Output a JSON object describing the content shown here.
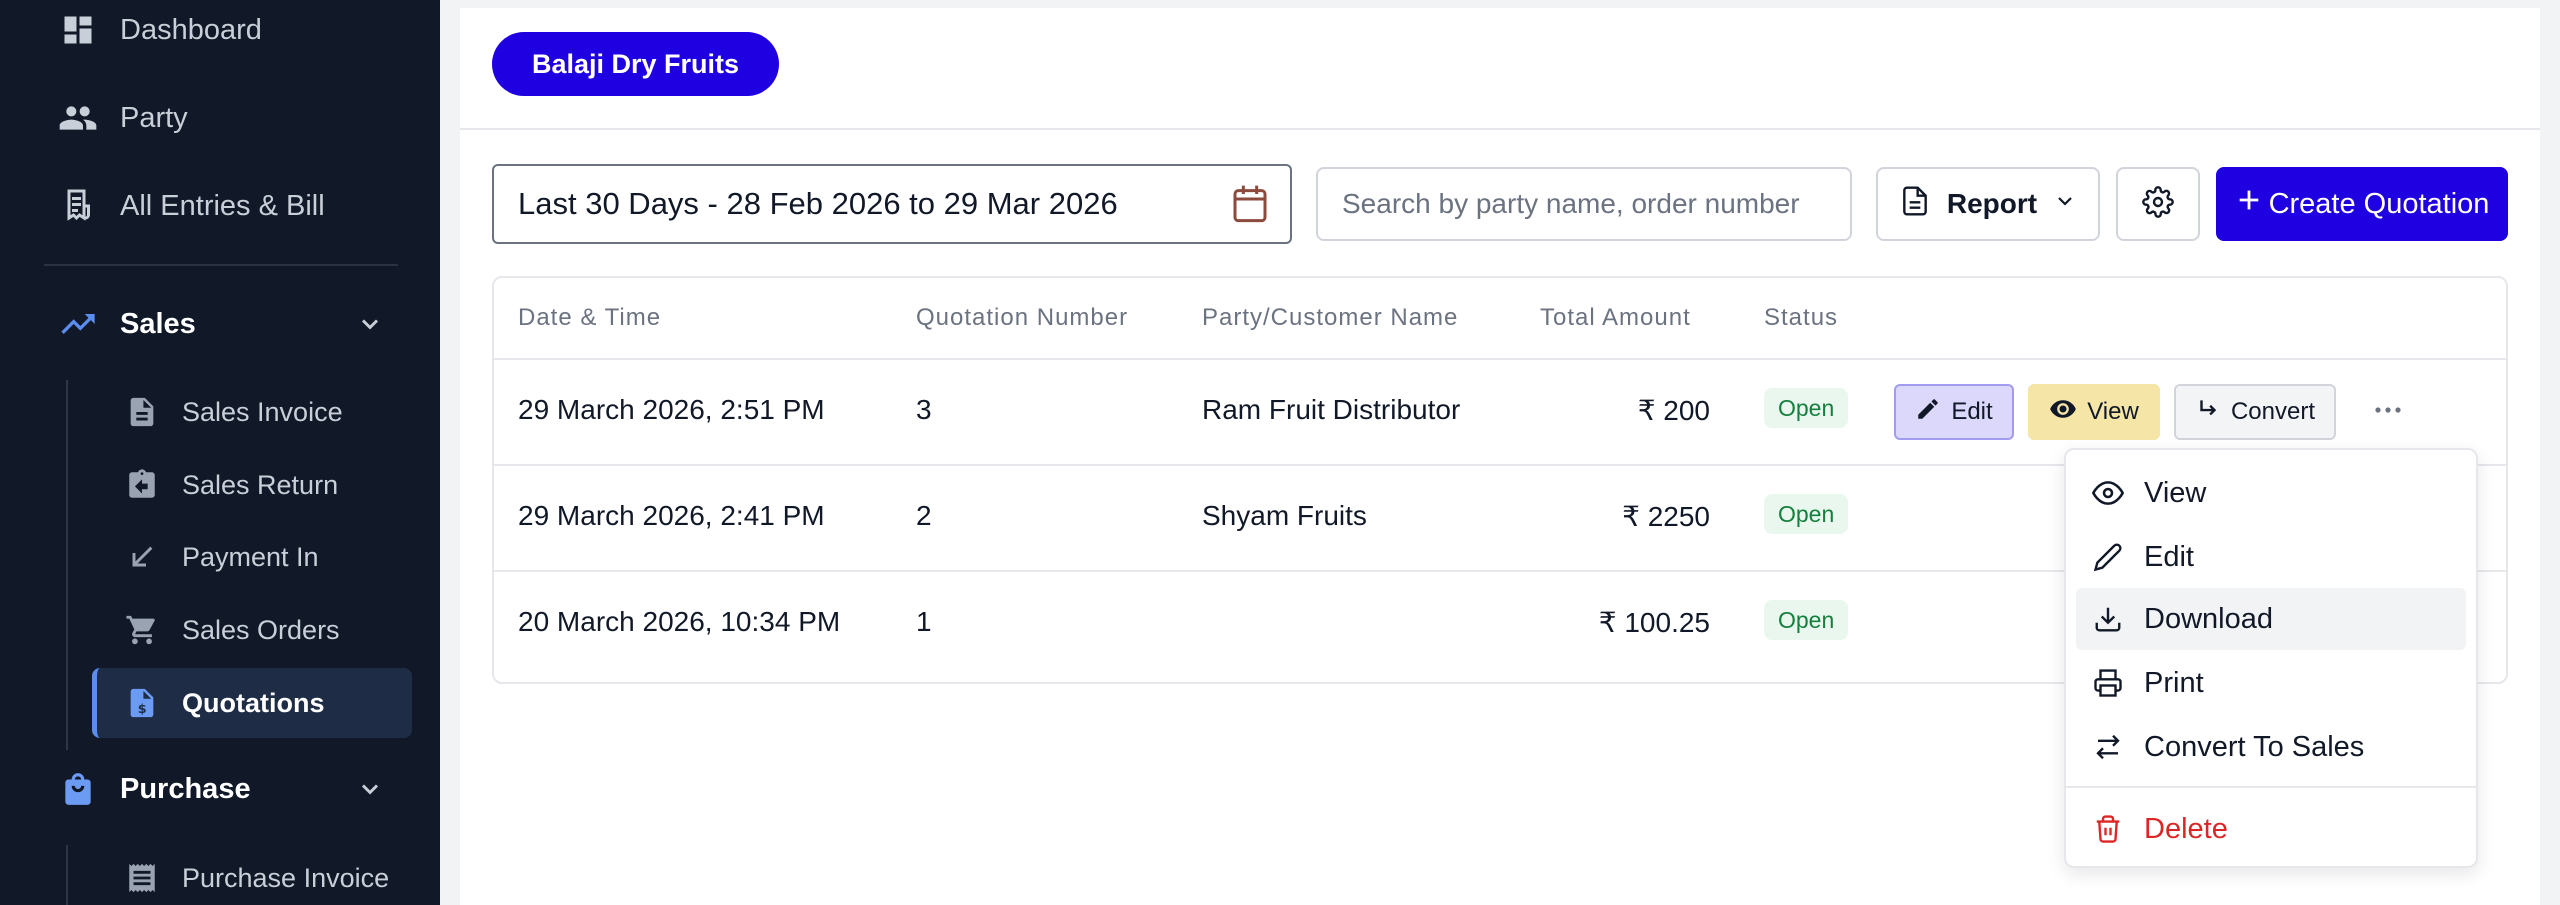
{
  "sidebar": {
    "items": [
      {
        "label": "Dashboard",
        "icon": "dashboard-icon"
      },
      {
        "label": "Party",
        "icon": "party-icon"
      },
      {
        "label": "All Entries & Bill",
        "icon": "receipt-icon"
      }
    ],
    "sales": {
      "label": "Sales",
      "icon": "trending-up-icon",
      "sub_items": [
        {
          "label": "Sales Invoice",
          "icon": "invoice-icon"
        },
        {
          "label": "Sales Return",
          "icon": "return-icon"
        },
        {
          "label": "Payment In",
          "icon": "arrow-down-left-icon"
        },
        {
          "label": "Sales Orders",
          "icon": "cart-icon"
        },
        {
          "label": "Quotations",
          "icon": "quotation-icon",
          "active": true
        }
      ]
    },
    "purchase": {
      "label": "Purchase",
      "icon": "shopping-bag-icon",
      "sub_items": [
        {
          "label": "Purchase Invoice",
          "icon": "receipt-icon"
        }
      ]
    }
  },
  "header": {
    "company": "Balaji Dry Fruits"
  },
  "toolbar": {
    "date_range": "Last 30 Days - 28 Feb 2026 to 29 Mar 2026",
    "search_placeholder": "Search by party name, order number",
    "report_label": "Report",
    "create_label": "Create Quotation"
  },
  "table": {
    "columns": [
      "Date & Time",
      "Quotation Number",
      "Party/Customer Name",
      "Total Amount",
      "Status"
    ],
    "rows": [
      {
        "date": "29 March 2026, 2:51 PM",
        "number": "3",
        "party": "Ram Fruit Distributor",
        "amount": "₹ 200",
        "status": "Open"
      },
      {
        "date": "29 March 2026, 2:41 PM",
        "number": "2",
        "party": "Shyam Fruits",
        "amount": "₹ 2250",
        "status": "Open"
      },
      {
        "date": "20 March 2026, 10:34 PM",
        "number": "1",
        "party": "",
        "amount": "₹ 100.25",
        "status": "Open"
      }
    ],
    "row_actions": {
      "edit": "Edit",
      "view": "View",
      "convert": "Convert"
    }
  },
  "menu": {
    "items": [
      {
        "label": "View",
        "icon": "eye-icon"
      },
      {
        "label": "Edit",
        "icon": "pencil-icon"
      },
      {
        "label": "Download",
        "icon": "download-icon",
        "highlighted": true
      },
      {
        "label": "Print",
        "icon": "printer-icon"
      },
      {
        "label": "Convert To Sales",
        "icon": "swap-icon"
      },
      {
        "label": "Delete",
        "icon": "trash-icon",
        "danger": true
      }
    ]
  },
  "colors": {
    "sidebar_bg": "#111827",
    "brand": "#1f00e0",
    "status_green": "#15803d",
    "danger": "#dc2626"
  }
}
